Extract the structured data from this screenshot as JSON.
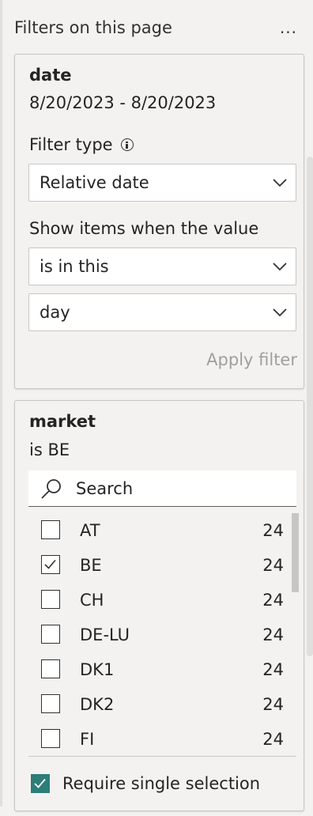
{
  "header": {
    "title": "Filters on this page",
    "more": "..."
  },
  "date_card": {
    "title": "date",
    "summary": "8/20/2023 - 8/20/2023",
    "filter_type_label": "Filter type",
    "filter_type_value": "Relative date",
    "show_items_label": "Show items when the value",
    "condition_value": "is in this",
    "period_value": "day",
    "apply_label": "Apply filter"
  },
  "market_card": {
    "title": "market",
    "summary": "is BE",
    "search_placeholder": "Search",
    "items": [
      {
        "label": "AT",
        "count": "24",
        "checked": false
      },
      {
        "label": "BE",
        "count": "24",
        "checked": true
      },
      {
        "label": "CH",
        "count": "24",
        "checked": false
      },
      {
        "label": "DE-LU",
        "count": "24",
        "checked": false
      },
      {
        "label": "DK1",
        "count": "24",
        "checked": false
      },
      {
        "label": "DK2",
        "count": "24",
        "checked": false
      },
      {
        "label": "FI",
        "count": "24",
        "checked": false
      }
    ],
    "require_single_label": "Require single selection",
    "require_single_checked": true
  },
  "colors": {
    "accent": "#2d7d78",
    "pane_bg": "#f3f2f1",
    "border": "#c8c6c4",
    "disabled_text": "#a19f9d"
  }
}
